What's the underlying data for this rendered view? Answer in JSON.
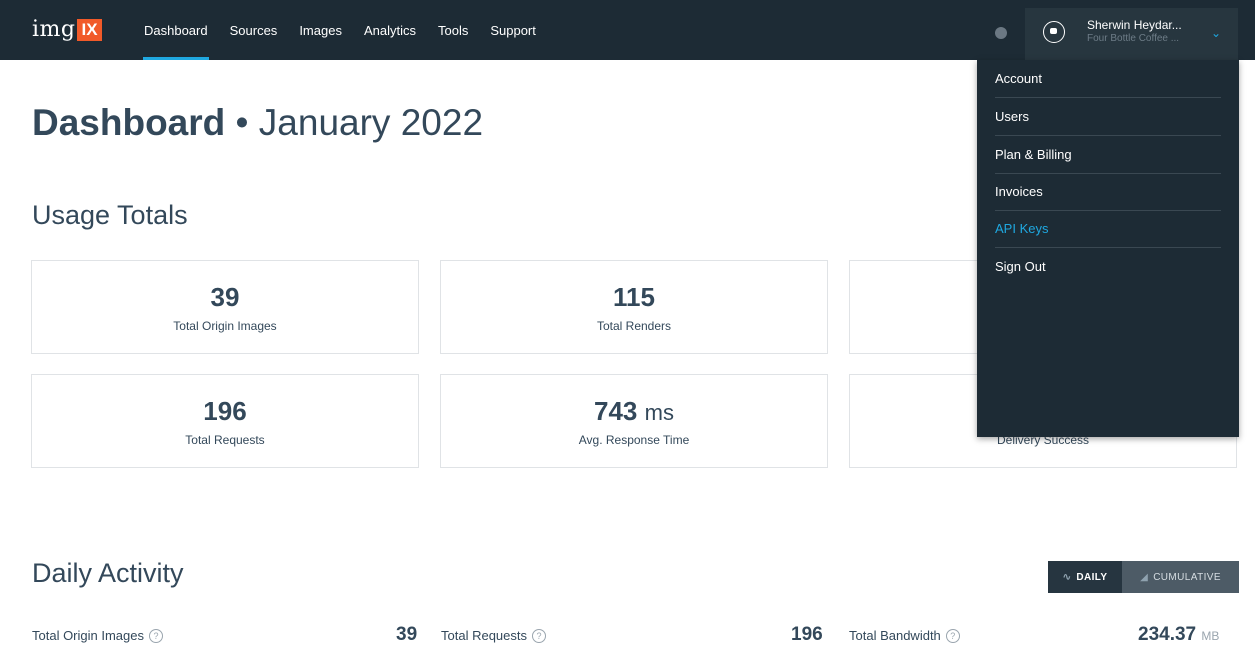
{
  "header": {
    "logo_text": "img",
    "logo_box": "IX",
    "nav": [
      "Dashboard",
      "Sources",
      "Images",
      "Analytics",
      "Tools",
      "Support"
    ],
    "active_nav": "Dashboard",
    "accent_color": "#1fa8e0",
    "user": {
      "name": "Sherwin Heydar...",
      "org": "Four Bottle Coffee ..."
    }
  },
  "dropdown": {
    "items": [
      "Account",
      "Users",
      "Plan & Billing",
      "Invoices",
      "API Keys",
      "Sign Out"
    ],
    "highlighted": "API Keys"
  },
  "page": {
    "title": "Dashboard",
    "separator": "•",
    "month": "January 2022"
  },
  "usage": {
    "title": "Usage Totals",
    "cards": [
      {
        "value": "39",
        "unit": "",
        "label": "Total Origin Images"
      },
      {
        "value": "115",
        "unit": "",
        "label": "Total Renders"
      },
      {
        "value": "196",
        "unit": "",
        "label": "Total Requests"
      },
      {
        "value": "743",
        "unit": "ms",
        "label": "Avg. Response Time"
      },
      {
        "value": "",
        "unit": "",
        "label": "Delivery Success"
      }
    ]
  },
  "daily": {
    "title": "Daily Activity",
    "toggle": {
      "daily": "DAILY",
      "cumulative": "CUMULATIVE",
      "selected": "DAILY"
    },
    "stats": [
      {
        "label": "Total Origin Images",
        "value": "39",
        "unit": ""
      },
      {
        "label": "Total Requests",
        "value": "196",
        "unit": ""
      },
      {
        "label": "Total Bandwidth",
        "value": "234.37",
        "unit": "MB"
      }
    ]
  }
}
